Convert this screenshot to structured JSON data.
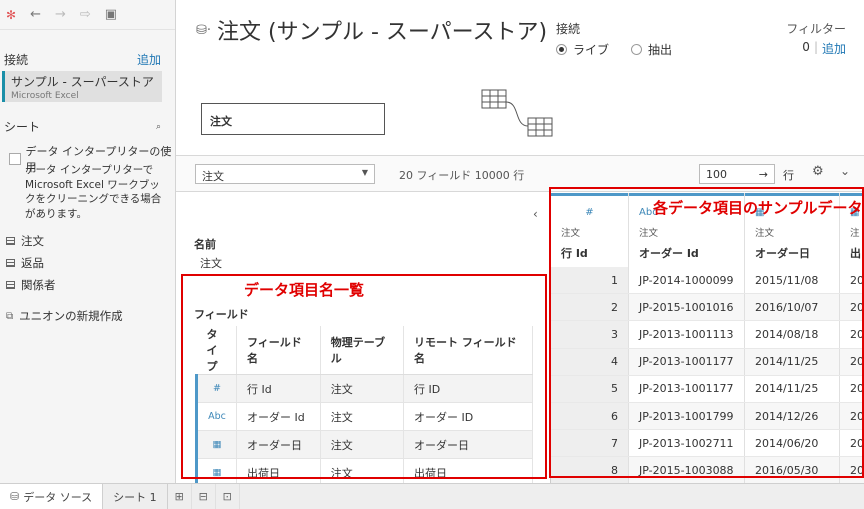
{
  "toolbar": {
    "icons": [
      "tableau-logo-icon",
      "back-icon",
      "forward-icon",
      "refresh-icon",
      "save-icon"
    ]
  },
  "left": {
    "connections_label": "接続",
    "add_label": "追加",
    "connection": {
      "name": "サンプル - スーパーストア",
      "type": "Microsoft Excel"
    },
    "sheets_label": "シート",
    "interpreter_label": "データ インタープリターの使用",
    "interpreter_desc": "データ インタープリターで Microsoft Excel ワークブックをクリーニングできる場合があります。",
    "sheets": [
      "注文",
      "返品",
      "関係者"
    ],
    "new_union": "ユニオンの新規作成"
  },
  "header": {
    "title": "注文 (サンプル - スーパーストア)",
    "connection_label": "接続",
    "live": "ライブ",
    "extract": "抽出",
    "filter_label": "フィルター",
    "filter_count": "0",
    "filter_add": "追加"
  },
  "canvas": {
    "table_name": "注文"
  },
  "bar": {
    "table_select": "注文",
    "field_info": "20 フィールド 10000 行",
    "row_limit": "100",
    "rows_label": "行"
  },
  "meta": {
    "name_label": "名前",
    "name_value": "注文",
    "fields_label": "フィールド",
    "columns": [
      "タイプ",
      "フィールド名",
      "物理テーブル",
      "リモート フィールド名"
    ],
    "rows": [
      {
        "type": "#",
        "name": "行 Id",
        "table": "注文",
        "remote": "行 ID"
      },
      {
        "type": "Abc",
        "name": "オーダー Id",
        "table": "注文",
        "remote": "オーダー ID"
      },
      {
        "type": "▦",
        "name": "オーダー日",
        "table": "注文",
        "remote": "オーダー日"
      },
      {
        "type": "▦",
        "name": "出荷日",
        "table": "注文",
        "remote": "出荷日"
      }
    ]
  },
  "grid": {
    "columns": [
      {
        "type": "#",
        "table": "注文",
        "name": "行 Id"
      },
      {
        "type": "Abc",
        "table": "注文",
        "name": "オーダー Id"
      },
      {
        "type": "▦",
        "table": "注文",
        "name": "オーダー日"
      },
      {
        "type": "▦",
        "table": "注",
        "name": "出"
      }
    ],
    "rows": [
      [
        "1",
        "JP-2014-1000099",
        "2015/11/08",
        "20"
      ],
      [
        "2",
        "JP-2015-1001016",
        "2016/10/07",
        "20"
      ],
      [
        "3",
        "JP-2013-1001113",
        "2014/08/18",
        "20"
      ],
      [
        "4",
        "JP-2013-1001177",
        "2014/11/25",
        "20"
      ],
      [
        "5",
        "JP-2013-1001177",
        "2014/11/25",
        "20"
      ],
      [
        "6",
        "JP-2013-1001799",
        "2014/12/26",
        "20"
      ],
      [
        "7",
        "JP-2013-1002711",
        "2014/06/20",
        "20"
      ],
      [
        "8",
        "JP-2015-1003088",
        "2016/05/30",
        "20"
      ]
    ]
  },
  "annotations": {
    "fields_list": "データ項目名一覧",
    "sample_data": "各データ項目のサンプルデータ"
  },
  "tabs": {
    "datasource": "データ ソース",
    "sheet1": "シート 1"
  },
  "colors": {
    "annotation": "#e00000",
    "accent": "#4e98c8",
    "link": "#1f77b4"
  }
}
